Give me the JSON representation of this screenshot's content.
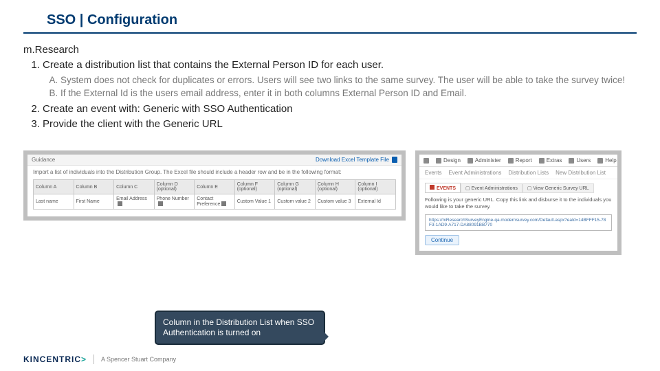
{
  "title": "SSO | Configuration",
  "subhead": "m.Research",
  "steps": {
    "s1": "Create a distribution list that contains the External Person ID for each user.",
    "s1a": "System does not check for duplicates or errors. Users will see two links to the same survey. The user will be able to take the survey twice!",
    "s1b": "If the External Id is the users email address, enter it in both columns External Person ID and Email.",
    "s2": "Create an event with: Generic with SSO Authentication",
    "s3": "Provide the client with the Generic URL"
  },
  "shotA": {
    "guidance": "Guidance",
    "download": "Download Excel Template File",
    "desc": "Import a list of individuals into the Distribution Group. The Excel file should include a header row and be in the following format:",
    "headers": [
      "Column A",
      "Column B",
      "Column C",
      "Column D (optional)",
      "Column E",
      "Column F (optional)",
      "Column G (optional)",
      "Column H (optional)",
      "Column I (optional)"
    ],
    "row": [
      "Last name",
      "First Name",
      "Email Address",
      "Phone Number",
      "Contact Preference",
      "Custom Value 1",
      "Custom value 2",
      "Custom value 3",
      "External Id"
    ]
  },
  "shotB": {
    "nav": [
      "Design",
      "Administer",
      "Report",
      "Extras",
      "Users",
      "Help"
    ],
    "row2": [
      "Events",
      "Event Administrations",
      "Distribution Lists",
      "New Distribution List"
    ],
    "crumbs": [
      "EVENTS",
      "Event Administrations",
      "View Generic Survey URL"
    ],
    "para": "Following is your generic URL. Copy this link and disburse it to the individuals you would like to take the survey.",
    "url": "https://mResearchSurveyEngine-qa.modernsurvey.com/Default.aspx?eaId=14BFFF15-78F3-1AD9-A717-DA88091BB770",
    "continue": "Continue"
  },
  "callout": "Column in the Distribution List when SSO Authentication is turned on",
  "brand": {
    "main": "KINCENTRIC",
    "accent": ">",
    "sub": "A Spencer Stuart Company"
  }
}
